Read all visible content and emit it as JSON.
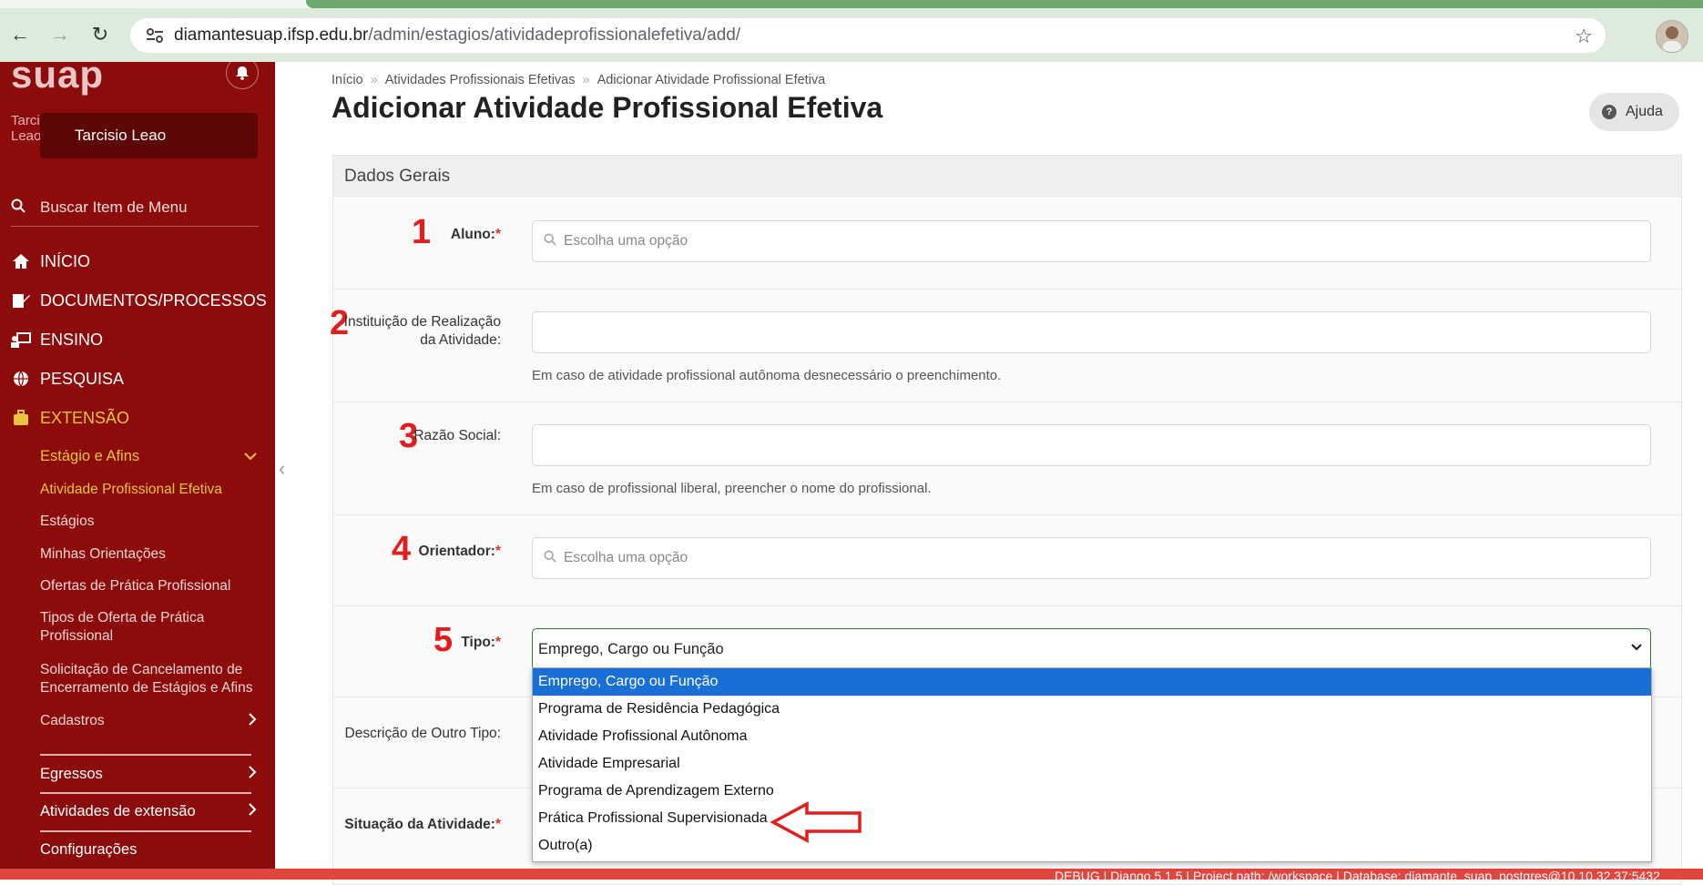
{
  "browser": {
    "url_host": "diamantesuap.ifsp.edu.br",
    "url_path": "/admin/estagios/atividadeprofissionalefetiva/add/"
  },
  "sidebar": {
    "logo": "suap",
    "user_avatar_text": "Tarcisio Leao",
    "user_name": "Tarcisio Leao",
    "search_placeholder": "Buscar Item de Menu",
    "menu": [
      {
        "label": "INÍCIO",
        "icon": "home-icon"
      },
      {
        "label": "DOCUMENTOS/PROCESSOS",
        "icon": "document-edit-icon"
      },
      {
        "label": "ENSINO",
        "icon": "teacher-icon"
      },
      {
        "label": "PESQUISA",
        "icon": "globe-icon"
      },
      {
        "label": "EXTENSÃO",
        "icon": "briefcase-icon"
      }
    ],
    "submenu_header": "Estágio e Afins",
    "submenu": [
      "Atividade Profissional Efetiva",
      "Estágios",
      "Minhas Orientações",
      "Ofertas de Prática Profissional",
      "Tipos de Oferta de Prática Profissional",
      "Solicitação de Cancelamento de Encerramento de Estágios e Afins",
      "Cadastros"
    ],
    "sections": [
      "Egressos",
      "Atividades de extensão",
      "Configurações"
    ]
  },
  "breadcrumb": [
    "Início",
    "Atividades Profissionais Efetivas",
    "Adicionar Atividade Profissional Efetiva"
  ],
  "breadcrumb_sep": "»",
  "page_title": "Adicionar Atividade Profissional Efetiva",
  "help_label": "Ajuda",
  "panel_title": "Dados Gerais",
  "form": {
    "aluno_label": "Aluno:",
    "aluno_placeholder": "Escolha uma opção",
    "instituicao_label_1": "Instituição de Realização",
    "instituicao_label_2": "da Atividade:",
    "instituicao_help": "Em caso de atividade profissional autônoma desnecessário o preenchimento.",
    "razao_label": "Razão Social:",
    "razao_help": "Em caso de profissional liberal, preencher o nome do profissional.",
    "orientador_label": "Orientador:",
    "orientador_placeholder": "Escolha uma opção",
    "tipo_label": "Tipo:",
    "tipo_value": "Emprego, Cargo ou Função",
    "descricao_label": "Descrição de Outro Tipo:",
    "situacao_label": "Situação da Atividade:",
    "required_mark": "*"
  },
  "annotations": [
    "1",
    "2",
    "3",
    "4",
    "5"
  ],
  "tipo_options": [
    "Emprego, Cargo ou Função",
    "Programa de Residência Pedagógica",
    "Atividade Profissional Autônoma",
    "Atividade Empresarial",
    "Programa de Aprendizagem Externo",
    "Prática Profissional Supervisionada",
    "Outro(a)"
  ],
  "debug_text": "DEBUG | Django 5.1.5 | Project path: /workspace | Database: diamante_suap_postgres@10.10.32.37:5432"
}
